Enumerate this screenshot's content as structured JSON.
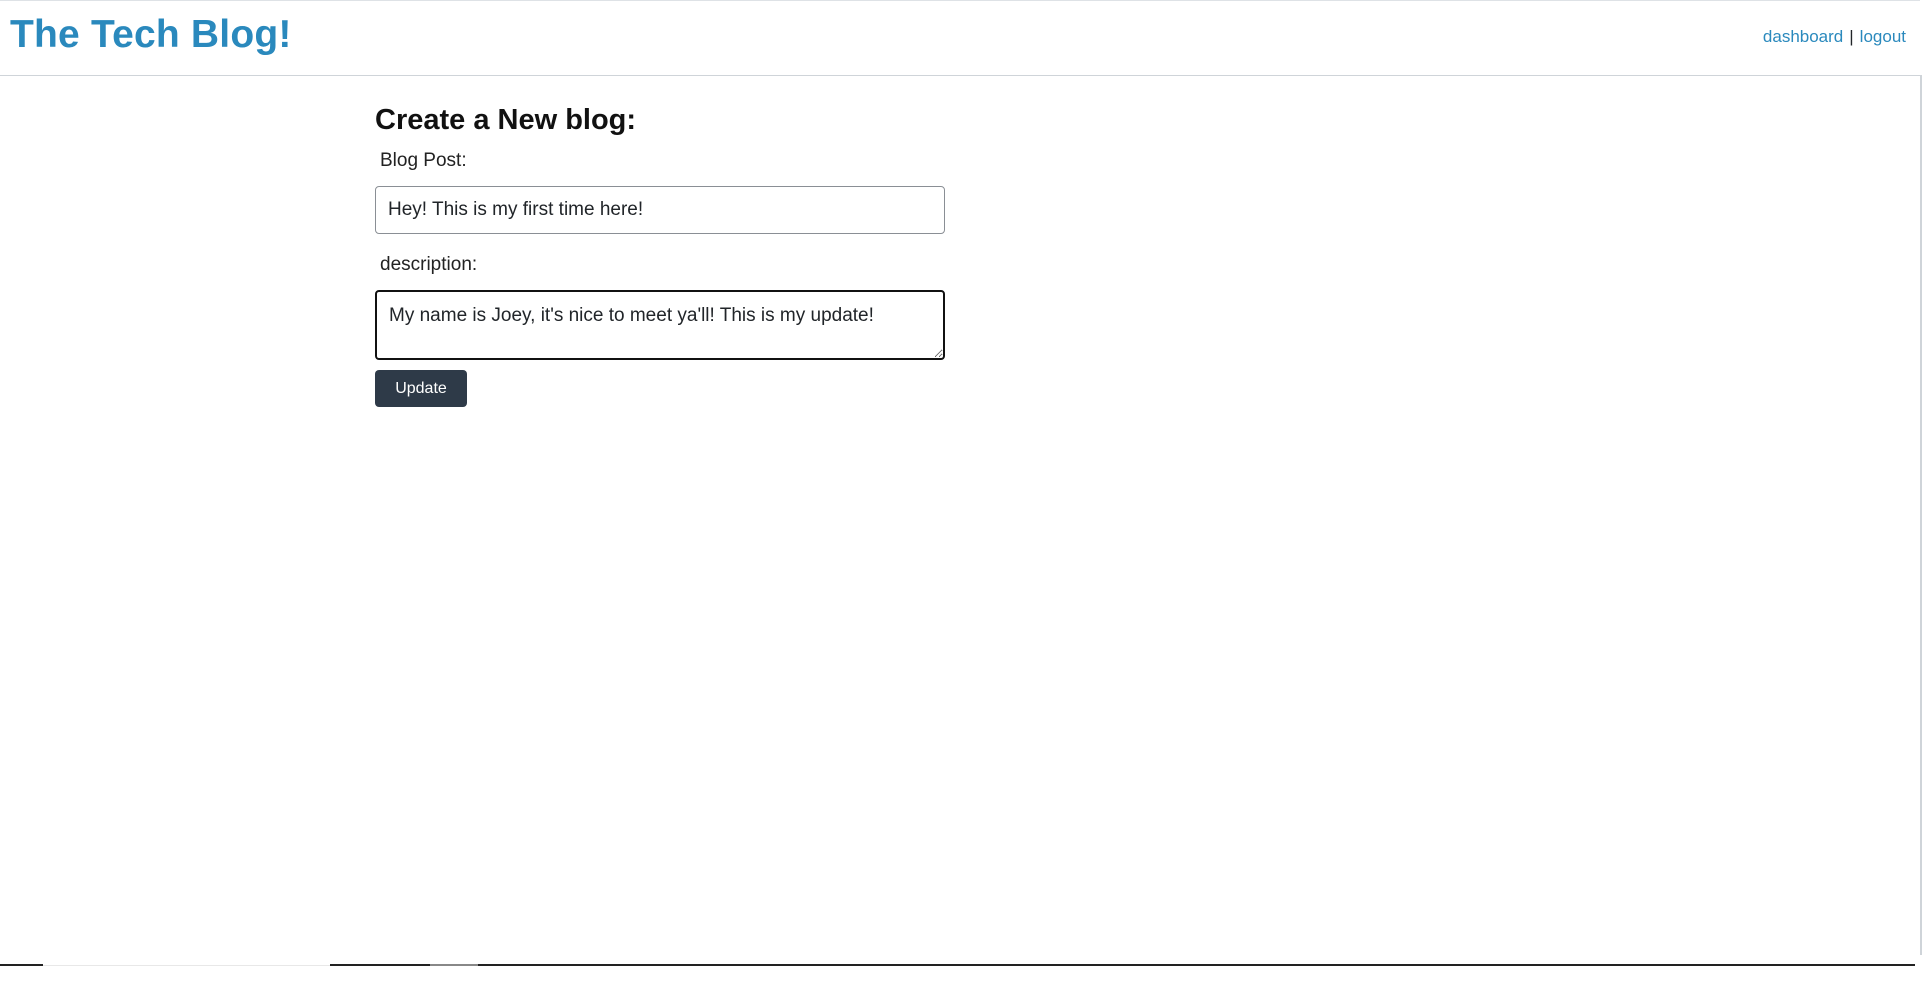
{
  "header": {
    "brand": "The Tech Blog!",
    "nav": {
      "dashboard_label": "dashboard",
      "separator": "|",
      "logout_label": "logout"
    }
  },
  "form": {
    "title": "Create a New blog:",
    "blog_post_label": "Blog Post:",
    "blog_post_value": "Hey! This is my first time here!",
    "description_label": "description:",
    "description_value": "My name is Joey, it's nice to meet ya'll! This is my update!",
    "update_button_label": "Update"
  },
  "colors": {
    "brand": "#2a89bd",
    "link": "#2a89bd",
    "button_bg": "#2e3a48",
    "button_text": "#ffffff"
  }
}
